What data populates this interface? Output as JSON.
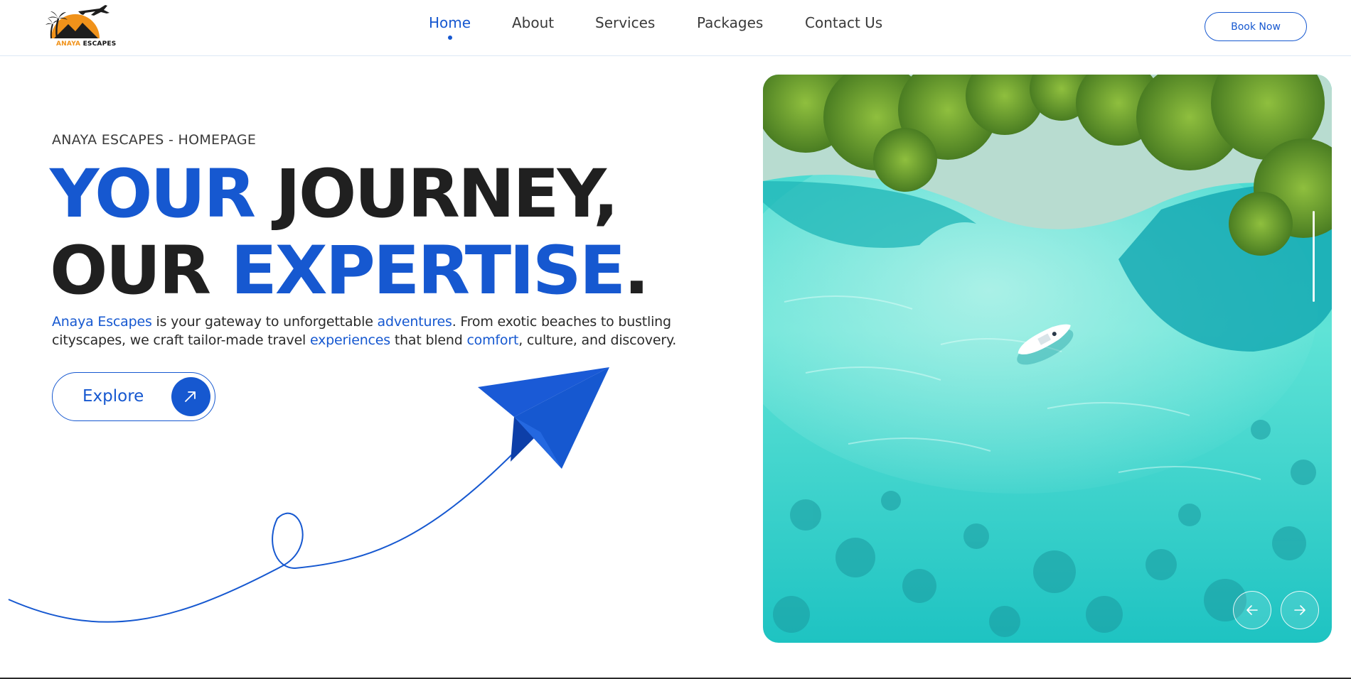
{
  "brand": {
    "logo_word1": "ANAYA",
    "logo_word2": "ESCAPES",
    "accent_color": "#1658d0",
    "logo_orange": "#f0921a"
  },
  "nav": {
    "items": [
      {
        "label": "Home",
        "active": true
      },
      {
        "label": "About",
        "active": false
      },
      {
        "label": "Services",
        "active": false
      },
      {
        "label": "Packages",
        "active": false
      },
      {
        "label": "Contact Us",
        "active": false
      }
    ],
    "cta_label": "Book Now"
  },
  "hero": {
    "eyebrow": "ANAYA ESCAPES - HOMEPAGE",
    "headline": {
      "line1_blue": "YOUR",
      "line1_dark": " JOURNEY,",
      "line2_dark": "OUR ",
      "line2_blue": "EXPERTISE",
      "line2_end": "."
    },
    "description": {
      "link1": "Anaya Escapes",
      "text1": " is your gateway to unforgettable ",
      "link2": "adventures",
      "text2": ". From exotic beaches to bustling cityscapes, we craft tailor-made travel ",
      "link3": "experiences",
      "text3": " that blend ",
      "link4": "comfort",
      "text4": ", culture, and discovery."
    },
    "explore_label": "Explore"
  },
  "slider": {
    "prev_icon": "arrow-left-icon",
    "next_icon": "arrow-right-icon"
  }
}
